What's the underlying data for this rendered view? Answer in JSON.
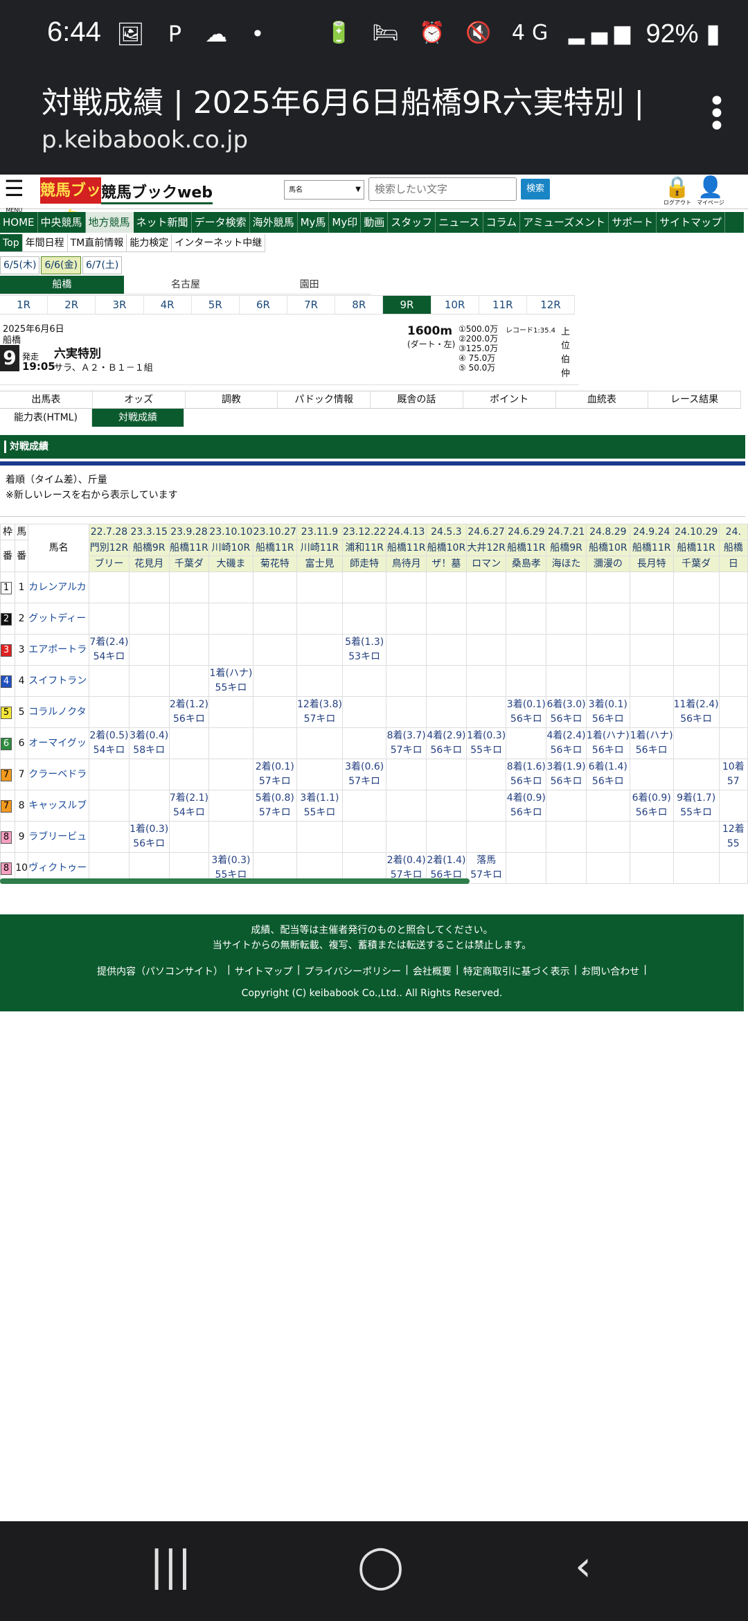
{
  "status": {
    "time": "6:44",
    "battery": "92%",
    "left_icons": "🖼 P ☁ •",
    "sys_icons": "🔋 🛏 ⏰ 🔇 4G ▂▄▆"
  },
  "browser": {
    "title": "対戦成績 | 2025年6月6日船橋9R六実特別 | ...",
    "url": "p.keibabook.co.jp"
  },
  "header": {
    "menu_label": "MENU",
    "logo": "競馬ブック",
    "site": "競馬ブックweb",
    "select_value": "馬名",
    "search_placeholder": "検索したい文字",
    "search_button": "検索",
    "logout": "ログアウト",
    "mypage": "マイページ"
  },
  "nav1": [
    "HOME",
    "中央競馬",
    "地方競馬",
    "ネット新聞",
    "データ検索",
    "海外競馬",
    "My馬",
    "My印",
    "動画",
    "スタッフ",
    "ニュース",
    "コラム",
    "アミューズメント",
    "サポート",
    "サイトマップ"
  ],
  "nav2": [
    "Top",
    "年間日程",
    "TM直前情報",
    "能力検定",
    "インターネット中継"
  ],
  "dates": [
    "6/5(木)",
    "6/6(金)",
    "6/7(土)"
  ],
  "venues": [
    "船橋",
    "名古屋",
    "園田"
  ],
  "races": [
    "1R",
    "2R",
    "3R",
    "4R",
    "5R",
    "6R",
    "7R",
    "8R",
    "9R",
    "10R",
    "11R",
    "12R"
  ],
  "race": {
    "date": "2025年6月6日",
    "venue": "船橋",
    "num": "9",
    "start_label": "発走",
    "start_time": "19:05",
    "name": "六実特別",
    "cls": "サラ、Ａ２・Ｂ１－１組",
    "dist": "1600m",
    "track": "(ダート・左)",
    "prizes": [
      "①500.0万",
      "②200.0万",
      "③125.0万",
      "④ 75.0万",
      "⑤ 50.0万"
    ],
    "record": "レコード1:35.4",
    "side": [
      "上",
      "位",
      "伯",
      "仲"
    ]
  },
  "tabs1": [
    "出馬表",
    "オッズ",
    "調教",
    "パドック情報",
    "厩舎の話",
    "ポイント",
    "血統表",
    "レース結果"
  ],
  "tabs2": [
    "能力表(HTML)",
    "対戦成績"
  ],
  "section_title": "対戦成績",
  "notes": [
    "着順（タイム差）、斤量",
    "※新しいレースを右から表示しています"
  ],
  "grid": {
    "head": {
      "waku": "枠",
      "uma": "馬",
      "ban1": "番",
      "ban2": "番",
      "name": "馬名"
    },
    "races": [
      [
        "22.7.28",
        "門別12R",
        "ブリー"
      ],
      [
        "23.3.15",
        "船橋9R",
        "花見月"
      ],
      [
        "23.9.28",
        "船橋11R",
        "千葉ダ"
      ],
      [
        "23.10.10",
        "川崎10R",
        "大磯ま"
      ],
      [
        "23.10.27",
        "船橋11R",
        "菊花特"
      ],
      [
        "23.11.9",
        "川崎11R",
        "富士見"
      ],
      [
        "23.12.22",
        "浦和11R",
        "師走特"
      ],
      [
        "24.4.13",
        "船橋11R",
        "鳥待月"
      ],
      [
        "24.5.3",
        "船橋10R",
        "ザ！墓"
      ],
      [
        "24.6.27",
        "大井12R",
        "ロマン"
      ],
      [
        "24.6.29",
        "船橋11R",
        "桑島孝"
      ],
      [
        "24.7.21",
        "船橋9R",
        "海ほた"
      ],
      [
        "24.8.29",
        "船橋10R",
        "瀰漫の"
      ],
      [
        "24.9.24",
        "船橋11R",
        "長月特"
      ],
      [
        "24.10.29",
        "船橋11R",
        "千葉ダ"
      ],
      [
        "24.",
        "船橋",
        "日"
      ]
    ],
    "rows": [
      {
        "waku": "1",
        "ban": "1",
        "name": "カレンアルカ",
        "color": "#ffffff",
        "fg": "#000",
        "cells": [
          "",
          "",
          "",
          "",
          "",
          "",
          "",
          "",
          "",
          "",
          "",
          "",
          "",
          "",
          "",
          ""
        ]
      },
      {
        "waku": "2",
        "ban": "2",
        "name": "グットディー",
        "color": "#111111",
        "fg": "#fff",
        "cells": [
          "",
          "",
          "",
          "",
          "",
          "",
          "",
          "",
          "",
          "",
          "",
          "",
          "",
          "",
          "",
          ""
        ]
      },
      {
        "waku": "3",
        "ban": "3",
        "name": "エアポートラ",
        "color": "#e02020",
        "fg": "#fff",
        "cells": [
          "7着(2.4)\n54キロ",
          "",
          "",
          "",
          "",
          "",
          "5着(1.3)\n53キロ",
          "",
          "",
          "",
          "",
          "",
          "",
          "",
          "",
          ""
        ]
      },
      {
        "waku": "4",
        "ban": "4",
        "name": "スイフトラン",
        "color": "#2050c0",
        "fg": "#fff",
        "cells": [
          "",
          "",
          "",
          "1着(ハナ)\n55キロ",
          "",
          "",
          "",
          "",
          "",
          "",
          "",
          "",
          "",
          "",
          "",
          ""
        ]
      },
      {
        "waku": "5",
        "ban": "5",
        "name": "コラルノクタ",
        "color": "#f5e63a",
        "fg": "#000",
        "cells": [
          "",
          "",
          "2着(1.2)\n56キロ",
          "",
          "",
          "12着(3.8)\n57キロ",
          "",
          "",
          "",
          "",
          "3着(0.1)\n56キロ",
          "6着(3.0)\n56キロ",
          "3着(0.1)\n56キロ",
          "",
          "11着(2.4)\n56キロ",
          ""
        ]
      },
      {
        "waku": "6",
        "ban": "6",
        "name": "オーマイグッ",
        "color": "#2e8b3e",
        "fg": "#fff",
        "cells": [
          "2着(0.5)\n54キロ",
          "3着(0.4)\n58キロ",
          "",
          "",
          "",
          "",
          "",
          "8着(3.7)\n57キロ",
          "4着(2.9)\n56キロ",
          "1着(0.3)\n55キロ",
          "",
          "4着(2.4)\n56キロ",
          "1着(ハナ)\n56キロ",
          "1着(ハナ)\n56キロ",
          "",
          ""
        ]
      },
      {
        "waku": "7",
        "ban": "7",
        "name": "クラーベドラ",
        "color": "#f39a1e",
        "fg": "#000",
        "cells": [
          "",
          "",
          "",
          "",
          "2着(0.1)\n57キロ",
          "",
          "3着(0.6)\n57キロ",
          "",
          "",
          "",
          "8着(1.6)\n56キロ",
          "3着(1.9)\n56キロ",
          "6着(1.4)\n56キロ",
          "",
          "",
          "10着\n57"
        ]
      },
      {
        "waku": "7",
        "ban": "8",
        "name": "キャッスルブ",
        "color": "#f39a1e",
        "fg": "#000",
        "cells": [
          "",
          "",
          "7着(2.1)\n54キロ",
          "",
          "5着(0.8)\n57キロ",
          "3着(1.1)\n55キロ",
          "",
          "",
          "",
          "",
          "4着(0.9)\n56キロ",
          "",
          "",
          "6着(0.9)\n56キロ",
          "9着(1.7)\n55キロ",
          ""
        ]
      },
      {
        "waku": "8",
        "ban": "9",
        "name": "ラブリービュ",
        "color": "#f5a0c0",
        "fg": "#000",
        "cells": [
          "",
          "1着(0.3)\n56キロ",
          "",
          "",
          "",
          "",
          "",
          "",
          "",
          "",
          "",
          "",
          "",
          "",
          "",
          "12着\n55"
        ]
      },
      {
        "waku": "8",
        "ban": "10",
        "name": "ヴィクトゥー",
        "color": "#f5a0c0",
        "fg": "#000",
        "cells": [
          "",
          "",
          "",
          "3着(0.3)\n55キロ",
          "",
          "",
          "",
          "2着(0.4)\n57キロ",
          "2着(1.4)\n56キロ",
          "落馬\n57キロ",
          "",
          "",
          "",
          "",
          "",
          ""
        ]
      }
    ]
  },
  "footer": {
    "line1": "成績、配当等は主催者発行のものと照合してください。",
    "line2": "当サイトからの無断転載、複写、蓄積または転送することは禁止します。",
    "links": [
      "提供内容（パソコンサイト）",
      "|",
      "サイトマップ",
      "|",
      "プライバシーポリシー",
      "|",
      "会社概要",
      "|",
      "特定商取引に基づく表示",
      "|",
      "お問い合わせ",
      "|"
    ],
    "copyright": "Copyright (C) keibabook Co.,Ltd.. All Rights Reserved."
  },
  "navbar": {
    "recent": "|||",
    "home": "◯",
    "back": "‹"
  }
}
